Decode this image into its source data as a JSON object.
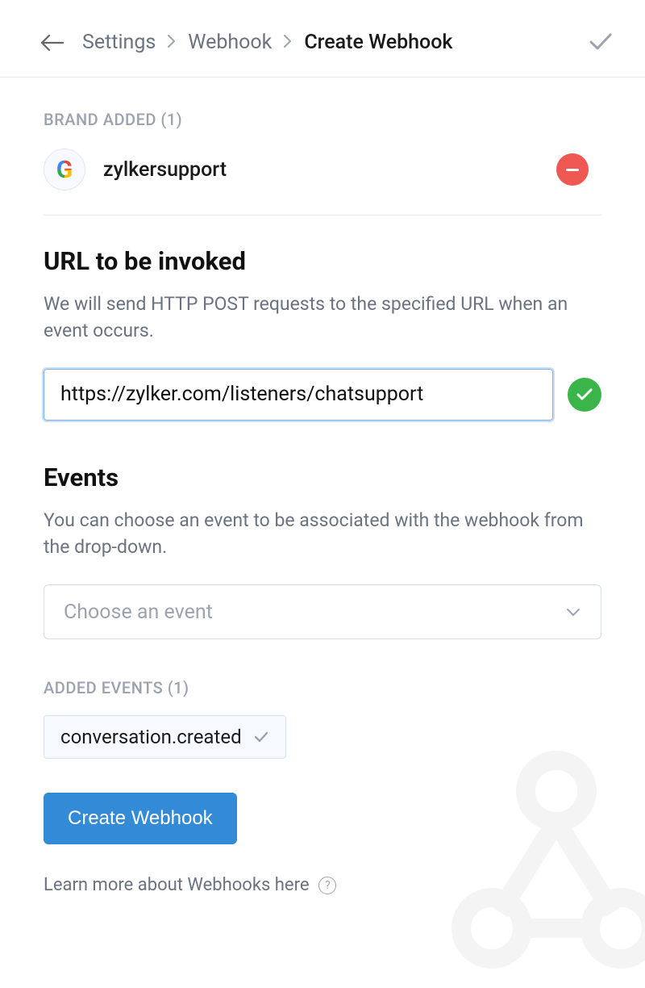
{
  "breadcrumb": {
    "items": [
      "Settings",
      "Webhook"
    ],
    "current": "Create Webhook"
  },
  "brand": {
    "section_label": "BRAND ADDED (1)",
    "name": "zylkersupport"
  },
  "url_section": {
    "title": "URL to be invoked",
    "description": "We will send HTTP POST requests to the specified URL when an event occurs.",
    "value": "https://zylker.com/listeners/chatsupport"
  },
  "events_section": {
    "title": "Events",
    "description": "You can choose an event to be associated with the webhook from the drop-down.",
    "select_placeholder": "Choose an event",
    "added_label": "ADDED EVENTS (1)",
    "added_event": "conversation.created"
  },
  "create_button": "Create Webhook",
  "learn_more": "Learn more about Webhooks here"
}
